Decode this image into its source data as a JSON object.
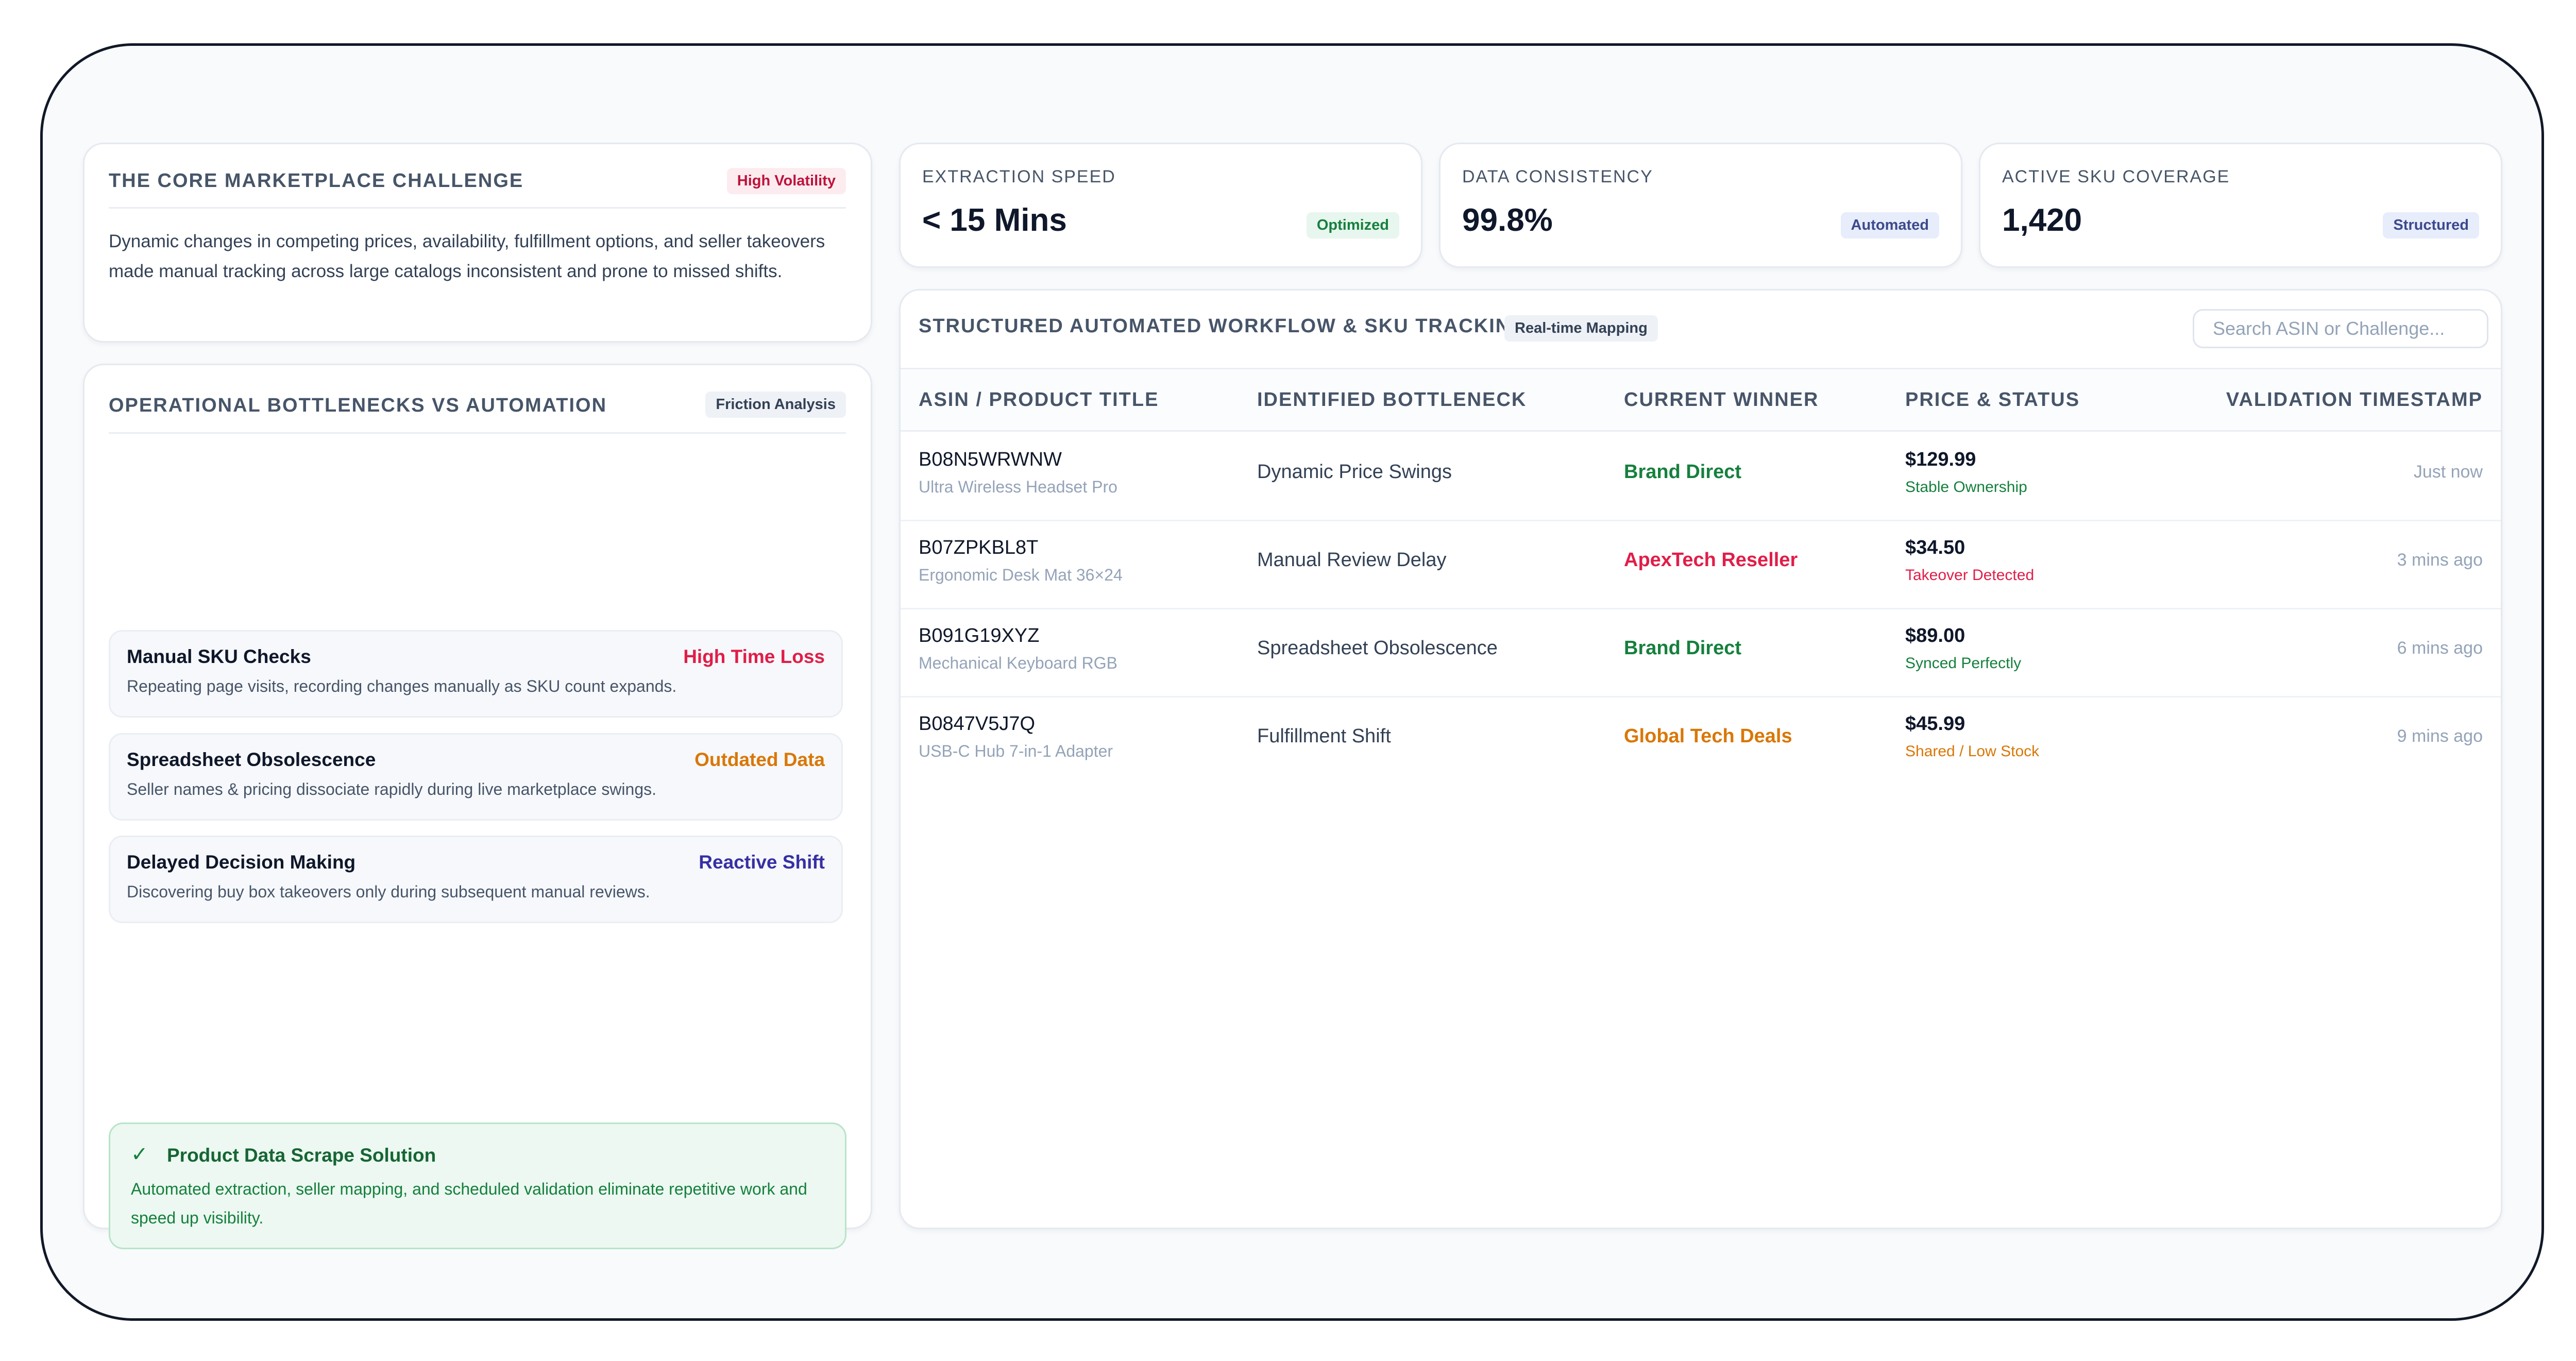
{
  "challenge": {
    "title": "THE CORE MARKETPLACE CHALLENGE",
    "badge": "High Volatility",
    "description": "Dynamic changes in competing prices, availability, fulfillment options, and seller takeovers made manual tracking across large catalogs inconsistent and prone to missed shifts."
  },
  "bottlenecks": {
    "title": "OPERATIONAL BOTTLENECKS VS AUTOMATION",
    "badge": "Friction Analysis",
    "items": [
      {
        "name": "Manual SKU Checks",
        "tag": "High Time Loss",
        "desc": "Repeating page visits, recording changes manually as SKU count expands."
      },
      {
        "name": "Spreadsheet Obsolescence",
        "tag": "Outdated Data",
        "desc": "Seller names & pricing dissociate rapidly during live marketplace swings."
      },
      {
        "name": "Delayed Decision Making",
        "tag": "Reactive Shift",
        "desc": "Discovering buy box takeovers only during subsequent manual reviews."
      }
    ],
    "solution": {
      "icon": "check-icon",
      "title": "Product Data Scrape Solution",
      "text": "Automated extraction, seller mapping, and scheduled validation eliminate repetitive work and speed up visibility."
    }
  },
  "stats": [
    {
      "label": "EXTRACTION SPEED",
      "value": "< 15 Mins",
      "badge": "Optimized"
    },
    {
      "label": "DATA CONSISTENCY",
      "value": "99.8%",
      "badge": "Automated"
    },
    {
      "label": "ACTIVE SKU COVERAGE",
      "value": "1,420",
      "badge": "Structured"
    }
  ],
  "workflow": {
    "title": "STRUCTURED AUTOMATED WORKFLOW & SKU TRACKING",
    "badge": "Real-time Mapping",
    "search_placeholder": "Search ASIN or Challenge...",
    "columns": [
      "ASIN / PRODUCT TITLE",
      "IDENTIFIED BOTTLENECK",
      "CURRENT WINNER",
      "PRICE & STATUS",
      "VALIDATION TIMESTAMP"
    ],
    "rows": [
      {
        "asin": "B08N5WRWNW",
        "title": "Ultra Wireless Headset Pro",
        "bottleneck": "Dynamic Price Swings",
        "winner": "Brand Direct",
        "price": "$129.99",
        "status": "Stable Ownership",
        "time": "Just now"
      },
      {
        "asin": "B07ZPKBL8T",
        "title": "Ergonomic Desk Mat 36×24",
        "bottleneck": "Manual Review Delay",
        "winner": "ApexTech Reseller",
        "price": "$34.50",
        "status": "Takeover Detected",
        "time": "3 mins ago"
      },
      {
        "asin": "B091G19XYZ",
        "title": "Mechanical Keyboard RGB",
        "bottleneck": "Spreadsheet Obsolescence",
        "winner": "Brand Direct",
        "price": "$89.00",
        "status": "Synced Perfectly",
        "time": "6 mins ago"
      },
      {
        "asin": "B0847V5J7Q",
        "title": "USB-C Hub 7-in-1 Adapter",
        "bottleneck": "Fulfillment Shift",
        "winner": "Global Tech Deals",
        "price": "$45.99",
        "status": "Shared / Low Stock",
        "time": "9 mins ago"
      }
    ]
  },
  "colors": {
    "green": "#15803d",
    "red": "#e11d48",
    "orange": "#d97706",
    "indigo": "#3730a3"
  }
}
